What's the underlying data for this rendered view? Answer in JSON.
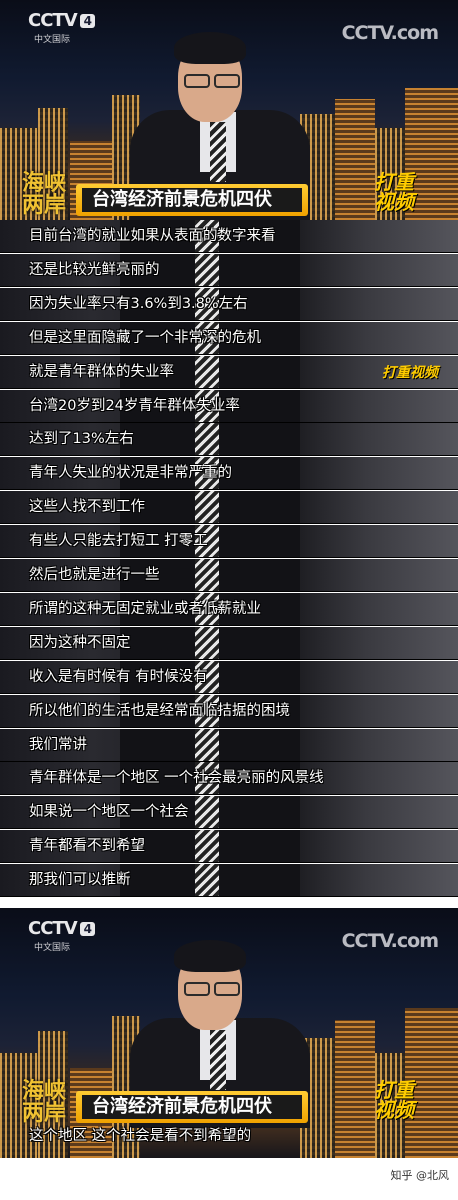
{
  "channel": {
    "logo_text": "CCTV",
    "channel_number": "4",
    "channel_name": "中文国际",
    "corner_logo": "CCTV.com"
  },
  "program": {
    "show_logo_line1": "海峡",
    "show_logo_line2": "两岸",
    "stamp_line1": "打重",
    "stamp_line2": "视频"
  },
  "headline": "台湾经济前景危机四伏",
  "subtitles": [
    "目前台湾的就业如果从表面的数字来看",
    "还是比较光鲜亮丽的",
    "因为失业率只有3.6%到3.8%左右",
    "但是这里面隐藏了一个非常深的危机",
    "就是青年群体的失业率",
    "台湾20岁到24岁青年群体失业率",
    "达到了13%左右",
    "青年人失业的状况是非常严重的",
    "这些人找不到工作",
    "有些人只能去打短工 打零工",
    "然后也就是进行一些",
    "所谓的这种无固定就业或者低薪就业",
    "因为这种不固定",
    "收入是有时候有 有时候没有",
    "所以他们的生活也是经常面临拮据的困境",
    "我们常讲",
    "青年群体是一个地区 一个社会最亮丽的风景线",
    "如果说一个地区一个社会",
    "青年都看不到希望",
    "那我们可以推断"
  ],
  "side_stamps": [
    "",
    "",
    "",
    "",
    "打重视频",
    "",
    "",
    "",
    "",
    "",
    "",
    "",
    "",
    "",
    "",
    "",
    "",
    "",
    "",
    ""
  ],
  "final_subtitle": "这个地区 这个社会是看不到希望的",
  "watermark": "知乎 @北风"
}
